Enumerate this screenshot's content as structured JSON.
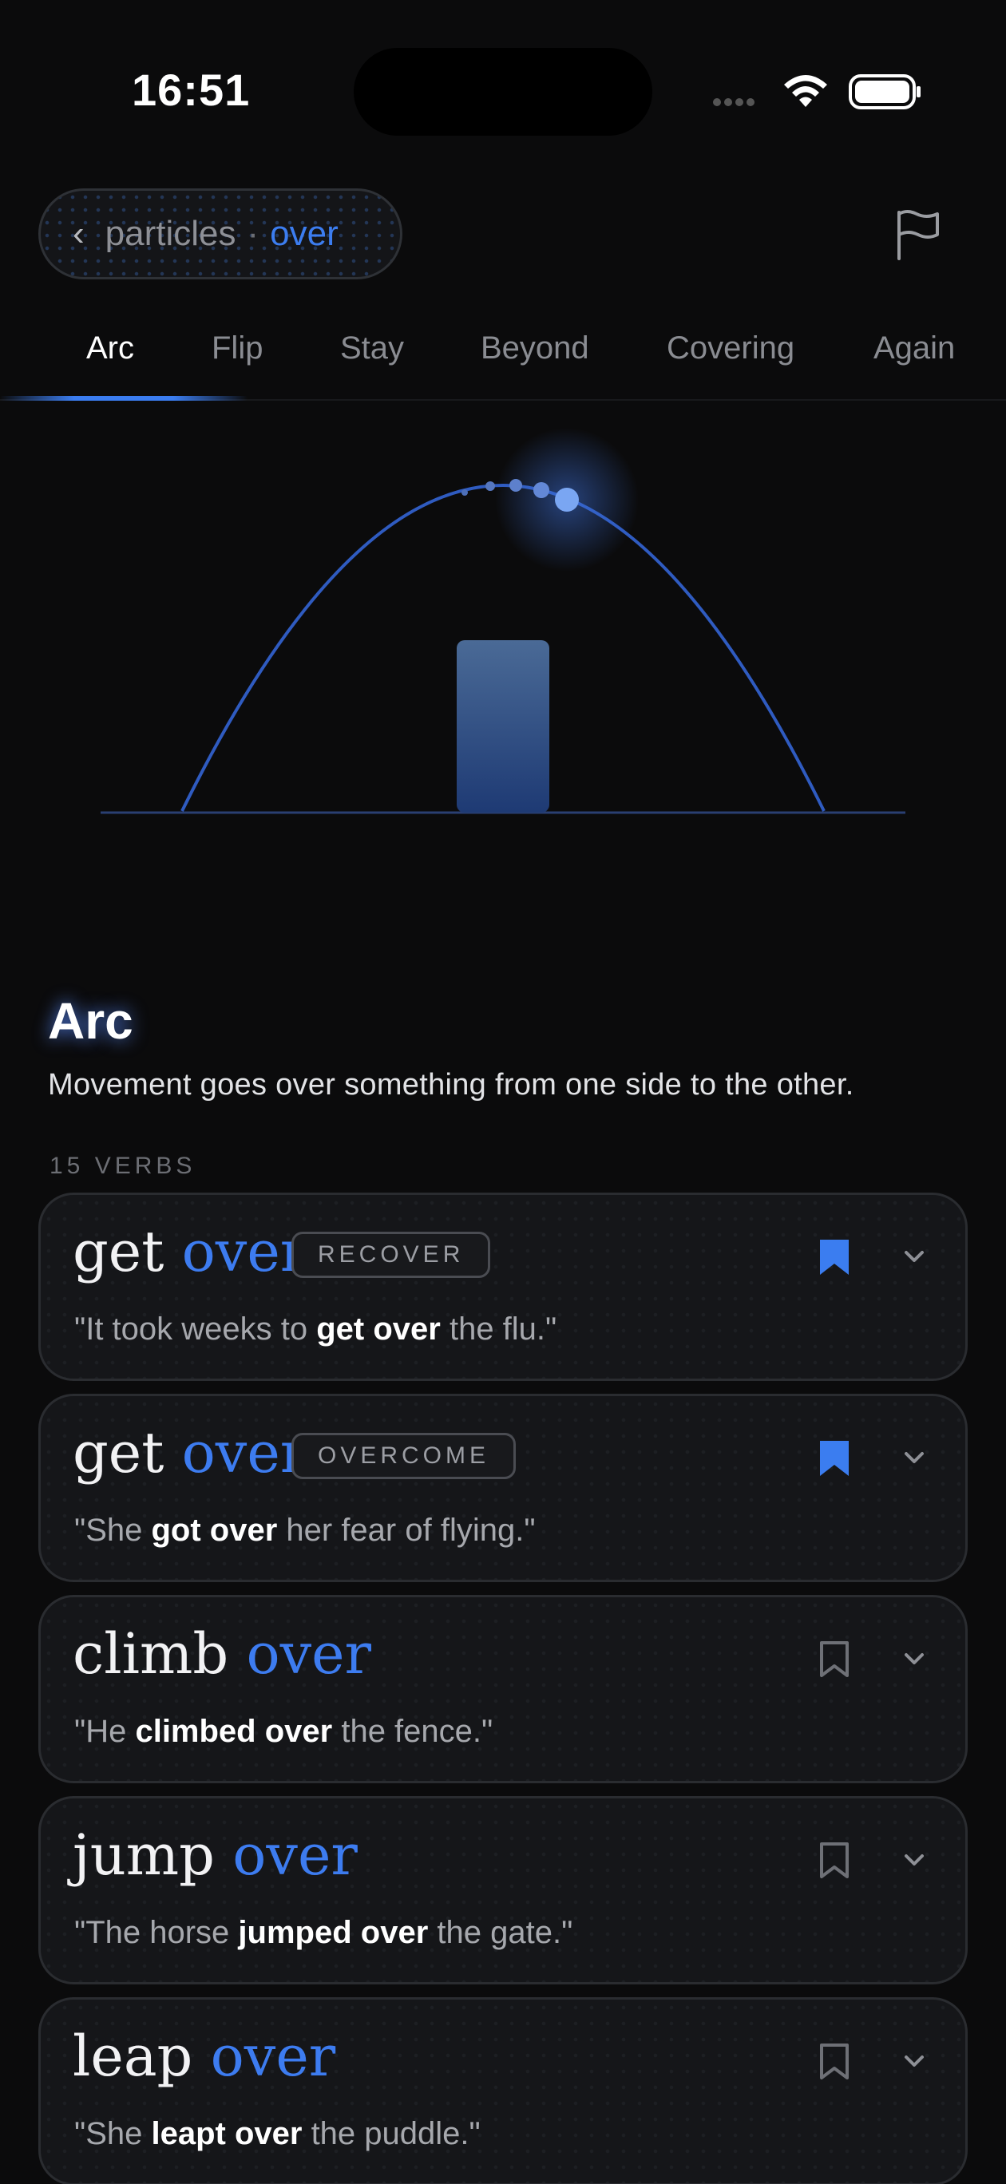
{
  "status": {
    "time": "16:51"
  },
  "header": {
    "back_label": "‹",
    "crumb_parent": "particles",
    "crumb_separator": "·",
    "crumb_current": "over"
  },
  "tabs": [
    {
      "label": "Arc",
      "active": true
    },
    {
      "label": "Flip",
      "active": false
    },
    {
      "label": "Stay",
      "active": false
    },
    {
      "label": "Beyond",
      "active": false
    },
    {
      "label": "Covering",
      "active": false
    },
    {
      "label": "Again",
      "active": false
    }
  ],
  "section": {
    "title": "Arc",
    "description": "Movement goes over something from one side to the other.",
    "count_label": "15 VERBS"
  },
  "verbs": [
    {
      "verb": "get",
      "particle": "over",
      "sense": "RECOVER",
      "example_pre": "\"It took weeks to ",
      "example_bold": "get over",
      "example_post": " the flu.\"",
      "bookmarked": true
    },
    {
      "verb": "get",
      "particle": "over",
      "sense": "OVERCOME",
      "example_pre": "\"She ",
      "example_bold": "got over",
      "example_post": " her fear of flying.\"",
      "bookmarked": true
    },
    {
      "verb": "climb",
      "particle": "over",
      "sense": "",
      "example_pre": "\"He ",
      "example_bold": "climbed over",
      "example_post": " the fence.\"",
      "bookmarked": false
    },
    {
      "verb": "jump",
      "particle": "over",
      "sense": "",
      "example_pre": "\"The horse ",
      "example_bold": "jumped over",
      "example_post": " the gate.\"",
      "bookmarked": false
    },
    {
      "verb": "leap",
      "particle": "over",
      "sense": "",
      "example_pre": "\"She ",
      "example_bold": "leapt over",
      "example_post": " the puddle.\"",
      "bookmarked": false
    }
  ],
  "colors": {
    "accent": "#3b7df0",
    "background": "#0b0b0c",
    "card": "#151619"
  },
  "icons": [
    "back-chevron-icon",
    "flag-icon",
    "wifi-icon",
    "battery-icon",
    "bookmark-icon",
    "chevron-down-icon"
  ]
}
